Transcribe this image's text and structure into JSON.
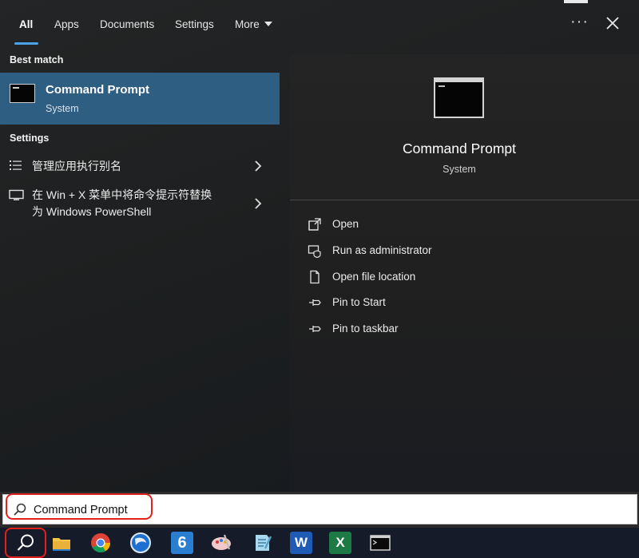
{
  "tabs": [
    {
      "label": "All",
      "active": true
    },
    {
      "label": "Apps"
    },
    {
      "label": "Documents"
    },
    {
      "label": "Settings"
    },
    {
      "label": "More"
    }
  ],
  "header": {
    "more_icon": "ellipsis-icon",
    "close_icon": "close-icon"
  },
  "results": {
    "best_match_heading": "Best match",
    "best_match": {
      "title": "Command Prompt",
      "subtitle": "System",
      "icon": "command-prompt-icon"
    },
    "settings_heading": "Settings",
    "settings_items": [
      {
        "label": "管理应用执行别名",
        "icon": "list-settings-icon"
      },
      {
        "label_line1": "在 Win + X 菜单中将命令提示符替换",
        "label_line2": "为 Windows PowerShell",
        "icon": "monitor-icon"
      }
    ]
  },
  "detail": {
    "title": "Command Prompt",
    "subtitle": "System",
    "actions": [
      {
        "label": "Open",
        "icon": "open-icon"
      },
      {
        "label": "Run as administrator",
        "icon": "shield-run-icon"
      },
      {
        "label": "Open file location",
        "icon": "file-location-icon"
      },
      {
        "label": "Pin to Start",
        "icon": "pin-icon"
      },
      {
        "label": "Pin to taskbar",
        "icon": "pin-icon"
      }
    ]
  },
  "search": {
    "value": "Command Prompt",
    "icon": "search-icon"
  },
  "taskbar": {
    "items": [
      "search-icon",
      "file-explorer-icon",
      "chrome-icon",
      "browser-icon",
      "app-6-icon",
      "paint-icon",
      "notepad-icon",
      "word-icon",
      "excel-icon",
      "terminal-icon"
    ],
    "app6_label": "6",
    "word_label": "W",
    "excel_label": "X"
  },
  "colors": {
    "accent": "#4aa3e8",
    "selected": "#2f5e83",
    "highlight": "#e0211c"
  }
}
